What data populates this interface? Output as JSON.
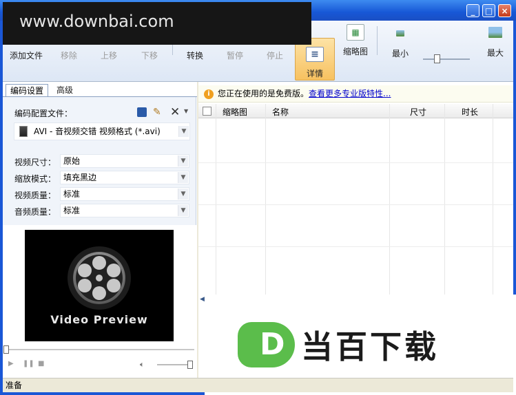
{
  "watermark": "www.downbai.com",
  "window": {
    "minimize": "_",
    "maximize": "□",
    "close": "×"
  },
  "toolbar": {
    "add": "添加文件",
    "remove": "移除",
    "up": "上移",
    "down": "下移",
    "convert": "转换",
    "pause": "暂停",
    "stop": "停止",
    "detail": "详情",
    "thumbnail": "缩略图",
    "min": "最小",
    "max": "最大"
  },
  "tabs": {
    "encode": "编码设置",
    "advanced": "高级"
  },
  "encode": {
    "profile_label": "编码配置文件：",
    "profile_value": "AVI - 音视频交错 视频格式 (*.avi)",
    "fields": [
      {
        "label": "视频尺寸：",
        "value": "原始"
      },
      {
        "label": "缩放模式：",
        "value": "填充黑边"
      },
      {
        "label": "视频质量：",
        "value": "标准"
      },
      {
        "label": "音频质量：",
        "value": "标准"
      }
    ]
  },
  "preview": {
    "caption": "Video Preview"
  },
  "notice": {
    "text": "您正在使用的是免费版。",
    "link": "查看更多专业版特性..."
  },
  "grid": {
    "columns": [
      "缩略图",
      "名称",
      "尺寸",
      "时长"
    ]
  },
  "logo": {
    "letter": "D",
    "text": "当百下载"
  },
  "status": "准备",
  "colors": {
    "accent": "#1a57d6",
    "logo_green": "#5bbd4b",
    "selected": "#f7c160"
  }
}
